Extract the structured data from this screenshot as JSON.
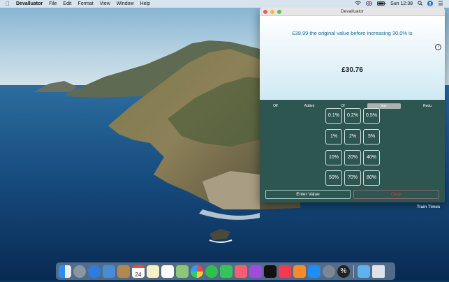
{
  "menubar": {
    "app_name": "Devalluator",
    "menus": [
      "File",
      "Edit",
      "Format",
      "View",
      "Window",
      "Help"
    ],
    "clock": "Sun 12:38"
  },
  "window": {
    "title": "Devalluator",
    "question": "£39.99 the original value before increasing 30.0% is",
    "answer": "£30.76",
    "tabs": [
      "Off",
      "Added",
      "Of",
      "Incr",
      "Redu"
    ],
    "selected_tab": "Incr",
    "percent_buttons": [
      "0.1%",
      "0.2%",
      "0.5%",
      "1%",
      "2%",
      "5%",
      "10%",
      "20%",
      "40%",
      "50%",
      "70%",
      "80%"
    ],
    "enter_label": "Enter Value",
    "clear_label": "Clear"
  },
  "desktop": {
    "widget_label": "Train Times"
  },
  "dock": {
    "calendar_date": "24",
    "icons": [
      "finder-icon",
      "launchpad-icon",
      "safari-icon",
      "photo-preview-icon",
      "contacts-icon",
      "calendar-icon",
      "notes-icon",
      "reminders-icon",
      "maps-icon",
      "photos-icon",
      "messages-icon",
      "facetime-icon",
      "music-icon",
      "podcasts-icon",
      "apple-tv-icon",
      "news-icon",
      "books-icon",
      "app-store-icon",
      "system-preferences-icon",
      "devalluator-icon",
      "downloads-folder-icon",
      "trash-icon"
    ]
  }
}
